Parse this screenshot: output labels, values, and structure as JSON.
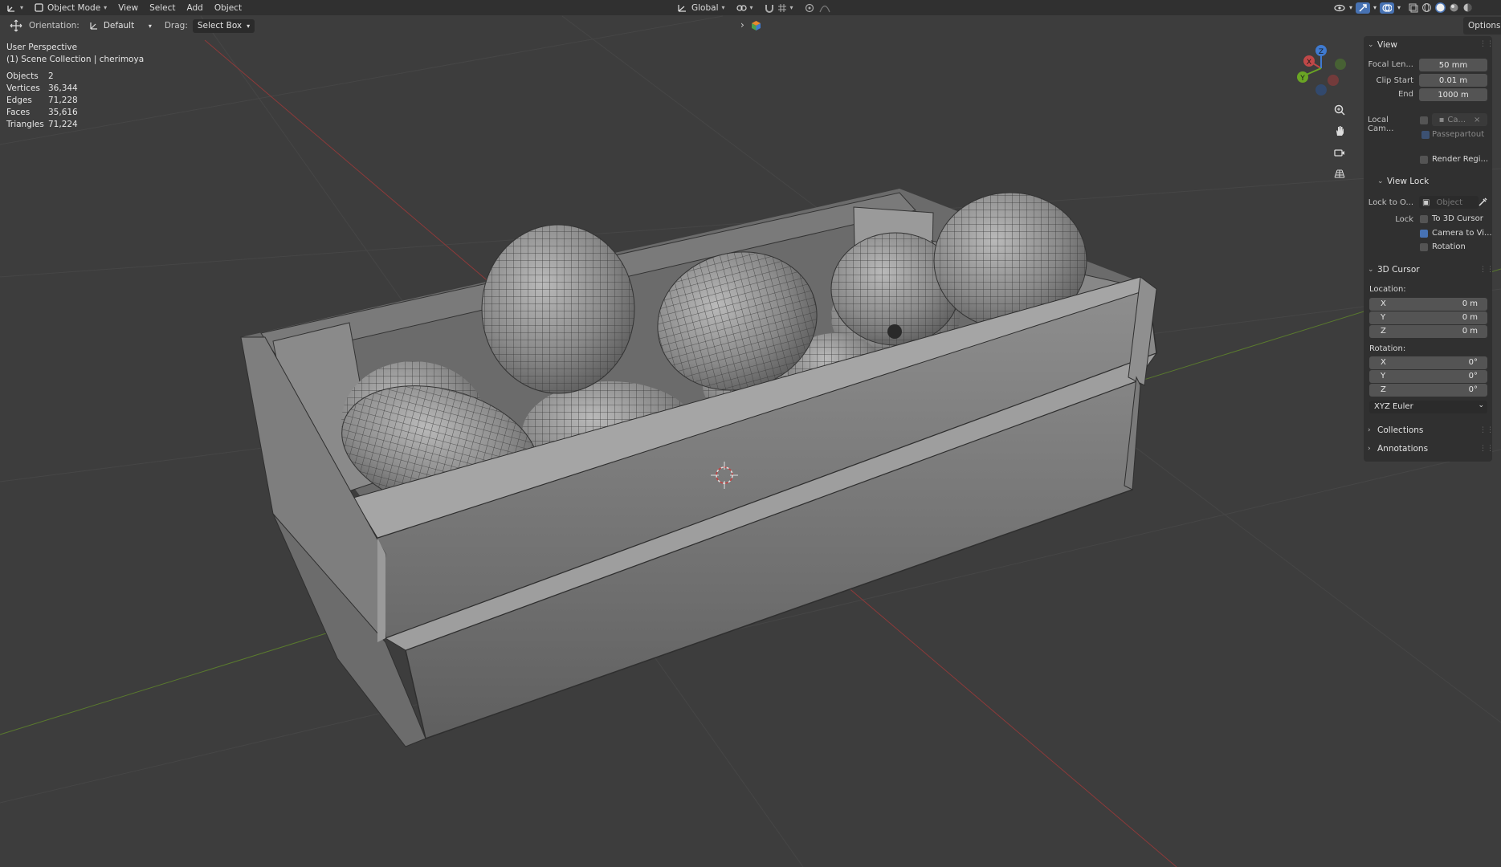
{
  "header": {
    "mode_label": "Object Mode",
    "menu": [
      "View",
      "Select",
      "Add",
      "Object"
    ],
    "transform_orientation": "Global"
  },
  "toolbar": {
    "orientation_label": "Orientation:",
    "orientation_value": "Default",
    "drag_label": "Drag:",
    "drag_value": "Select Box",
    "options_label": "Options"
  },
  "overlay": {
    "view_name": "User Perspective",
    "collection": "(1) Scene Collection | cherimoya",
    "stats": [
      {
        "k": "Objects",
        "v": "2"
      },
      {
        "k": "Vertices",
        "v": "36,344"
      },
      {
        "k": "Edges",
        "v": "71,228"
      },
      {
        "k": "Faces",
        "v": "35,616"
      },
      {
        "k": "Triangles",
        "v": "71,224"
      }
    ]
  },
  "gizmo": {
    "x": "X",
    "y": "Y",
    "z": "Z"
  },
  "panel": {
    "view": {
      "title": "View",
      "focal_label": "Focal Len...",
      "focal_value": "50 mm",
      "clip_start_label": "Clip Start",
      "clip_start_value": "0.01 m",
      "end_label": "End",
      "end_value": "1000 m",
      "local_camera_label": "Local Cam...",
      "local_camera_value": "Ca...",
      "passepartout_label": "Passepartout",
      "render_region_label": "Render Regi..."
    },
    "view_lock": {
      "title": "View Lock",
      "lock_to_label": "Lock to O...",
      "lock_to_placeholder": "Object",
      "lock_label": "Lock",
      "to_3d_cursor": "To 3D Cursor",
      "camera_to_view": "Camera to Vi...",
      "rotation": "Rotation"
    },
    "cursor": {
      "title": "3D Cursor",
      "location_label": "Location:",
      "location": [
        {
          "axis": "X",
          "value": "0 m"
        },
        {
          "axis": "Y",
          "value": "0 m"
        },
        {
          "axis": "Z",
          "value": "0 m"
        }
      ],
      "rotation_label": "Rotation:",
      "rotation": [
        {
          "axis": "X",
          "value": "0°"
        },
        {
          "axis": "Y",
          "value": "0°"
        },
        {
          "axis": "Z",
          "value": "0°"
        }
      ],
      "rotation_mode": "XYZ Euler"
    },
    "collections_title": "Collections",
    "annotations_title": "Annotations"
  }
}
